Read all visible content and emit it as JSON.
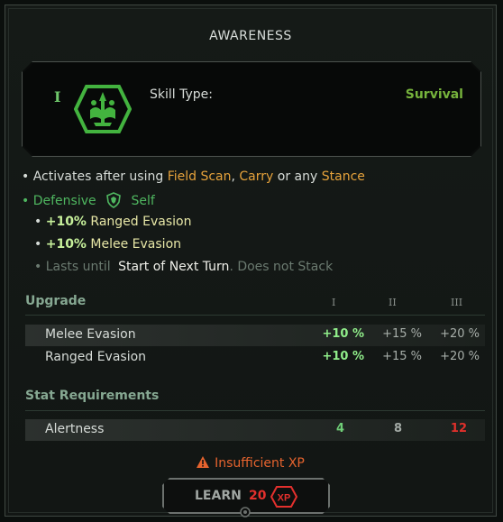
{
  "window": {
    "title": "AWARENESS"
  },
  "skill": {
    "tier": "I",
    "icon": "awareness-crest-icon",
    "type_label": "Skill Type:",
    "type_value": "Survival"
  },
  "description": {
    "line1": {
      "bullet": "•",
      "prefix": "Activates after using",
      "term1": "Field Scan",
      "sep": ",",
      "term2": "Carry",
      "mid": "or any",
      "term3": "Stance"
    },
    "line2": {
      "bullet": "•",
      "tag": "Defensive",
      "shield_icon": "shield-icon",
      "target": "Self"
    },
    "effects": [
      {
        "bullet": "•",
        "value": "+10%",
        "stat": "Ranged Evasion"
      },
      {
        "bullet": "•",
        "value": "+10%",
        "stat": "Melee Evasion"
      }
    ],
    "duration": {
      "bullet": "•",
      "prefix": "Lasts until",
      "term": "Start of Next Turn",
      "suffix": ". Does not Stack"
    }
  },
  "upgrade": {
    "header": "Upgrade",
    "tiers": [
      "I",
      "II",
      "III"
    ],
    "rows": [
      {
        "label": "Melee Evasion",
        "values": [
          "+10 %",
          "+15 %",
          "+20 %"
        ]
      },
      {
        "label": "Ranged Evasion",
        "values": [
          "+10 %",
          "+15 %",
          "+20 %"
        ]
      }
    ]
  },
  "requirements": {
    "header": "Stat Requirements",
    "rows": [
      {
        "label": "Alertness",
        "values": [
          "4",
          "8",
          "12"
        ]
      }
    ]
  },
  "warning": {
    "icon": "warning-icon",
    "text": "Insufficient XP"
  },
  "learn_button": {
    "label": "LEARN",
    "cost": "20",
    "currency": "XP"
  },
  "colors": {
    "survival": "#76b33c",
    "orange_terms": "#e6a23b",
    "green_tag": "#4fb760",
    "warning": "#e5632e",
    "insufficient": "#e3302d"
  }
}
